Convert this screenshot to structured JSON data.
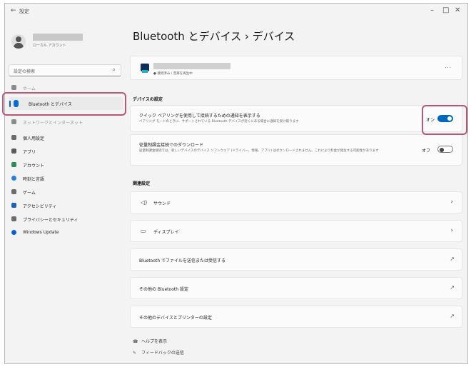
{
  "window": {
    "title": "設定",
    "back_glyph": "←",
    "controls": {
      "minimize": "–",
      "maximize": "□",
      "close": "✕"
    }
  },
  "account": {
    "type": "ローカル アカウント"
  },
  "search": {
    "placeholder": "設定の検索",
    "icon": "search-icon"
  },
  "sidebar": {
    "items": [
      {
        "label": "ホーム",
        "color": "#8a8a8a"
      },
      {
        "label": "Bluetooth とデバイス",
        "color": "#0a6ccf",
        "selected": true
      },
      {
        "label": "ネットワークとインターネット",
        "color": "#8a8a8a"
      },
      {
        "label": "個人用設定",
        "color": "#6b6b6b"
      },
      {
        "label": "アプリ",
        "color": "#5b5b5b"
      },
      {
        "label": "アカウント",
        "color": "#2e8b57"
      },
      {
        "label": "時刻と言語",
        "color": "#2a7fd4"
      },
      {
        "label": "ゲーム",
        "color": "#6b6b6b"
      },
      {
        "label": "アクセシビリティ",
        "color": "#1f5fb5"
      },
      {
        "label": "プライバシーとセキュリティ",
        "color": "#6b6b6b"
      },
      {
        "label": "Windows Update",
        "color": "#0f5fd0"
      }
    ]
  },
  "page": {
    "title": "Bluetooth とデバイス  ›  デバイス",
    "device": {
      "status": "● 接続済み / 音楽を再生中",
      "more": "···"
    },
    "device_settings_header": "デバイスの設定",
    "swift_pair": {
      "title": "クイック ペアリングを使用して接続するための通知を表示する",
      "desc": "ペアリング モードのときに、サポートされている Bluetooth デバイスが近くにある場合に通知を受け取ります",
      "state_label": "オン",
      "on": true
    },
    "metered_download": {
      "title": "従量制課金接続でのダウンロード",
      "desc": "従量制課金接続では、新しいデバイスのデバイス ソフトウェア (ドライバー、情報、アプリ) はダウンロードされません。これにより料金が発生する可能性があります",
      "state_label": "オフ",
      "on": false
    },
    "related_header": "関連設定",
    "related": [
      {
        "label": "サウンド",
        "icon": "speaker-icon",
        "trail": "›"
      },
      {
        "label": "ディスプレイ",
        "icon": "display-icon",
        "trail": "›"
      },
      {
        "label": "Bluetooth でファイルを送信または受信する",
        "trail": "↗"
      },
      {
        "label": "その他の Bluetooth 設定",
        "trail": "↗"
      },
      {
        "label": "その他のデバイスとプリンターの設定",
        "trail": "↗"
      }
    ],
    "links": [
      {
        "label": "ヘルプを表示",
        "icon": "help-icon"
      },
      {
        "label": "フィードバックの送信",
        "icon": "feedback-icon"
      }
    ]
  }
}
